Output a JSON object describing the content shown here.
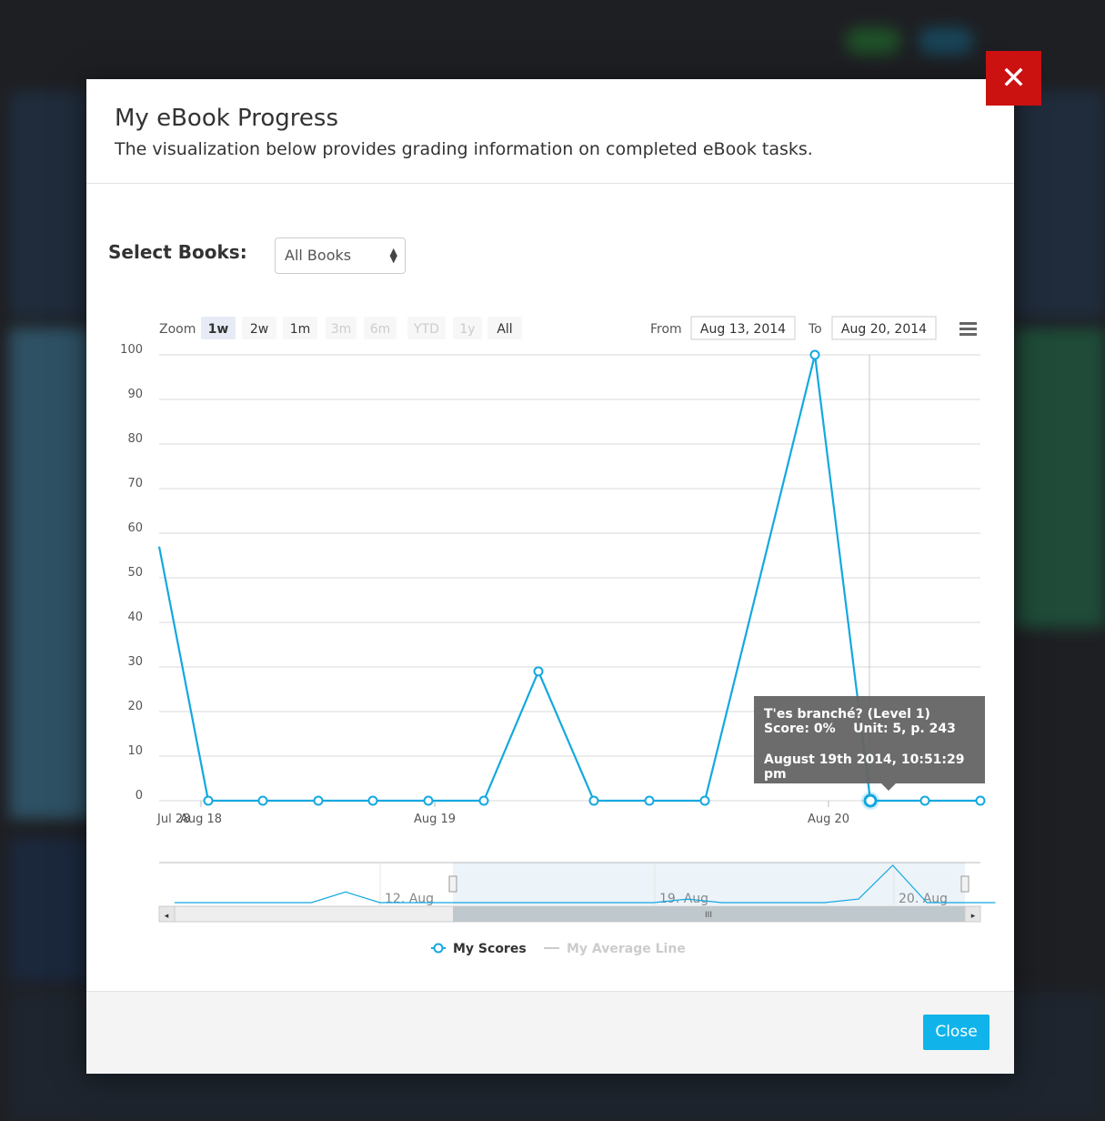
{
  "modal": {
    "title": "My eBook Progress",
    "subtitle": "The visualization below provides grading information on completed eBook tasks.",
    "close_icon": "close-x-icon",
    "footer_close_label": "Close"
  },
  "filter": {
    "label": "Select Books:",
    "selected": "All Books"
  },
  "range_selector": {
    "zoom_label": "Zoom",
    "buttons": [
      {
        "label": "1w",
        "state": "selected"
      },
      {
        "label": "2w",
        "state": "enabled"
      },
      {
        "label": "1m",
        "state": "enabled"
      },
      {
        "label": "3m",
        "state": "disabled"
      },
      {
        "label": "6m",
        "state": "disabled"
      },
      {
        "label": "YTD",
        "state": "disabled"
      },
      {
        "label": "1y",
        "state": "disabled"
      },
      {
        "label": "All",
        "state": "enabled"
      }
    ],
    "from_label": "From",
    "from_value": "Aug 13, 2014",
    "to_label": "To",
    "to_value": "Aug 20, 2014",
    "menu_icon": "hamburger-menu-icon"
  },
  "tooltip": {
    "title": "T'es branché? (Level 1)",
    "score_line": "Score: 0%    Unit: 5, p. 243",
    "date_line": "August 19th 2014, 10:51:29 pm"
  },
  "colors": {
    "series": "#13a8e0",
    "close_x_bg": "#cc1111",
    "close_button_bg": "#10b4ea"
  },
  "chart_data": {
    "type": "line",
    "y_ticks": [
      "0",
      "10",
      "20",
      "30",
      "40",
      "50",
      "60",
      "70",
      "80",
      "90",
      "100"
    ],
    "ylim": [
      0,
      100
    ],
    "x_ticks": [
      "Jul 28",
      "Aug 18",
      "Aug 19",
      "Aug 20"
    ],
    "series": [
      {
        "name": "My Scores",
        "values": [
          57,
          0,
          0,
          0,
          0,
          0,
          0,
          29,
          0,
          0,
          0,
          100,
          0,
          0,
          0
        ],
        "markers": [
          false,
          true,
          true,
          true,
          true,
          true,
          true,
          true,
          true,
          true,
          true,
          true,
          true,
          true,
          true
        ],
        "highlighted_index": 12
      }
    ],
    "legend": [
      {
        "name": "My Scores",
        "active": true
      },
      {
        "name": "My Average Line",
        "active": false
      }
    ],
    "legend_position": "bottom-center",
    "grid": true,
    "navigator": {
      "labels": [
        "12. Aug",
        "19. Aug",
        "20. Aug"
      ],
      "values": [
        0,
        0,
        0,
        0,
        0,
        6,
        0,
        0,
        0,
        0,
        0,
        0,
        0,
        0,
        0,
        2,
        0,
        0,
        0,
        0,
        2,
        21,
        0,
        0,
        0
      ]
    }
  }
}
